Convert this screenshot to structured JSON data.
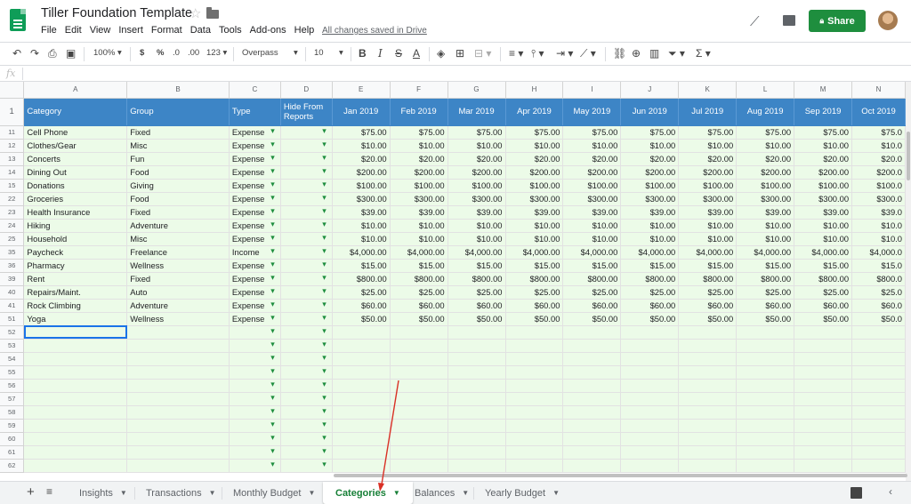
{
  "app": {
    "title": "Tiller Foundation Template",
    "menu": [
      "File",
      "Edit",
      "View",
      "Insert",
      "Format",
      "Data",
      "Tools",
      "Add-ons",
      "Help"
    ],
    "save_status": "All changes saved in Drive",
    "share_label": "Share",
    "icons": [
      "sheets-logo-icon",
      "star-icon",
      "folder-icon",
      "trending-icon",
      "comment-icon",
      "lock-icon",
      "avatar"
    ]
  },
  "toolbar": {
    "zoom": "100%",
    "currency": "$",
    "percent": "%",
    "dec_less": ".0",
    "dec_more": ".00",
    "more_formats": "123",
    "font": "Overpass",
    "font_size": "10"
  },
  "formula_bar": {
    "fx": "fx",
    "value": ""
  },
  "columns": [
    "A",
    "B",
    "C",
    "D",
    "E",
    "F",
    "G",
    "H",
    "I",
    "J",
    "K",
    "L",
    "M",
    "N"
  ],
  "header_row": {
    "row_number": "1",
    "cells": [
      "Category",
      "Group",
      "Type",
      "Hide From Reports",
      "Jan 2019",
      "Feb 2019",
      "Mar 2019",
      "Apr 2019",
      "May 2019",
      "Jun 2019",
      "Jul 2019",
      "Aug 2019",
      "Sep 2019",
      "Oct 2019"
    ]
  },
  "rows": [
    {
      "n": "11",
      "category": "Cell Phone",
      "group": "Fixed",
      "type": "Expense",
      "amt": "$75.00",
      "amt_cut": "$75.0"
    },
    {
      "n": "12",
      "category": "Clothes/Gear",
      "group": "Misc",
      "type": "Expense",
      "amt": "$10.00",
      "amt_cut": "$10.0"
    },
    {
      "n": "13",
      "category": "Concerts",
      "group": "Fun",
      "type": "Expense",
      "amt": "$20.00",
      "amt_cut": "$20.0"
    },
    {
      "n": "14",
      "category": "Dining Out",
      "group": "Food",
      "type": "Expense",
      "amt": "$200.00",
      "amt_cut": "$200.0"
    },
    {
      "n": "15",
      "category": "Donations",
      "group": "Giving",
      "type": "Expense",
      "amt": "$100.00",
      "amt_cut": "$100.0"
    },
    {
      "n": "22",
      "category": "Groceries",
      "group": "Food",
      "type": "Expense",
      "amt": "$300.00",
      "amt_cut": "$300.0"
    },
    {
      "n": "23",
      "category": "Health Insurance",
      "group": "Fixed",
      "type": "Expense",
      "amt": "$39.00",
      "amt_cut": "$39.0"
    },
    {
      "n": "24",
      "category": "Hiking",
      "group": "Adventure",
      "type": "Expense",
      "amt": "$10.00",
      "amt_cut": "$10.0"
    },
    {
      "n": "25",
      "category": "Household",
      "group": "Misc",
      "type": "Expense",
      "amt": "$10.00",
      "amt_cut": "$10.0"
    },
    {
      "n": "35",
      "category": "Paycheck",
      "group": "Freelance",
      "type": "Income",
      "amt": "$4,000.00",
      "amt_cut": "$4,000.0"
    },
    {
      "n": "36",
      "category": "Pharmacy",
      "group": "Wellness",
      "type": "Expense",
      "amt": "$15.00",
      "amt_cut": "$15.0"
    },
    {
      "n": "39",
      "category": "Rent",
      "group": "Fixed",
      "type": "Expense",
      "amt": "$800.00",
      "amt_cut": "$800.0"
    },
    {
      "n": "40",
      "category": "Repairs/Maint.",
      "group": "Auto",
      "type": "Expense",
      "amt": "$25.00",
      "amt_cut": "$25.0"
    },
    {
      "n": "41",
      "category": "Rock Climbing",
      "group": "Adventure",
      "type": "Expense",
      "amt": "$60.00",
      "amt_cut": "$60.0"
    },
    {
      "n": "51",
      "category": "Yoga",
      "group": "Wellness",
      "type": "Expense",
      "amt": "$50.00",
      "amt_cut": "$50.0"
    }
  ],
  "empty_rows": [
    "52",
    "53",
    "54",
    "55",
    "56",
    "57",
    "58",
    "59",
    "60",
    "61",
    "62"
  ],
  "sheet_tabs": [
    {
      "label": "Insights",
      "active": false
    },
    {
      "label": "Transactions",
      "active": false
    },
    {
      "label": "Monthly Budget",
      "active": false
    },
    {
      "label": "Categories",
      "active": true
    },
    {
      "label": "Balances",
      "active": false
    },
    {
      "label": "Yearly Budget",
      "active": false
    }
  ],
  "colors": {
    "header_blue": "#3d85c6",
    "row_green": "#ecfbe8",
    "share_green": "#1e8e3e",
    "active_tab": "#188038",
    "annotation_red": "#d93025",
    "selection": "#1a73e8"
  }
}
